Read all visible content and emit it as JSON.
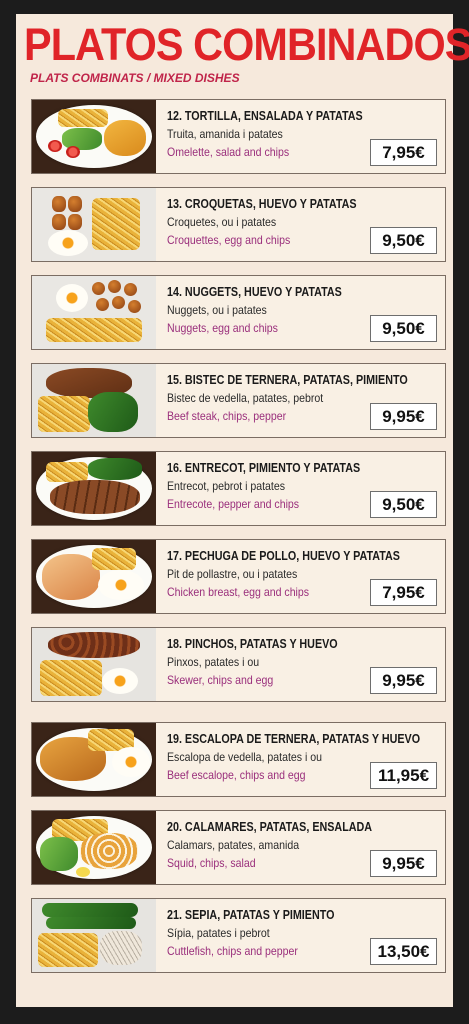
{
  "header": {
    "title": "PLATOS COMBINADOS",
    "subtitle": "PLATS COMBINATS  /  MIXED DISHES"
  },
  "items": [
    {
      "name": "12. TORTILLA, ENSALADA Y PATATAS",
      "catalan": "Truita, amanida i patates",
      "english": "Omelette, salad and chips",
      "price": "7,95€",
      "photo": "omelette-plate-image"
    },
    {
      "name": "13. CROQUETAS, HUEVO Y PATATAS",
      "catalan": "Croquetes, ou i patates",
      "english": "Croquettes, egg and chips",
      "price": "9,50€",
      "photo": "croquettes-plate-image"
    },
    {
      "name": "14. NUGGETS, HUEVO Y PATATAS",
      "catalan": "Nuggets, ou i patates",
      "english": "Nuggets, egg and chips",
      "price": "9,50€",
      "photo": "nuggets-plate-image"
    },
    {
      "name": "15. BISTEC DE TERNERA, PATATAS, PIMIENTO",
      "catalan": "Bistec de vedella, patates, pebrot",
      "english": "Beef steak, chips, pepper",
      "price": "9,95€",
      "photo": "beef-steak-plate-image"
    },
    {
      "name": "16. ENTRECOT, PIMIENTO Y PATATAS",
      "catalan": "Entrecot, pebrot i patates",
      "english": "Entrecote, pepper and chips",
      "price": "9,50€",
      "photo": "entrecote-plate-image"
    },
    {
      "name": "17. PECHUGA DE POLLO, HUEVO Y PATATAS",
      "catalan": "Pit de pollastre, ou i patates",
      "english": "Chicken breast, egg and chips",
      "price": "7,95€",
      "photo": "chicken-breast-plate-image"
    },
    {
      "name": "18. PINCHOS, PATATAS Y HUEVO",
      "catalan": "Pinxos, patates i ou",
      "english": "Skewer, chips and egg",
      "price": "9,95€",
      "photo": "skewer-plate-image"
    },
    {
      "name": "19. ESCALOPA DE TERNERA, PATATAS Y HUEVO",
      "catalan": "Escalopa de vedella, patates i ou",
      "english": "Beef escalope, chips and egg",
      "price": "11,95€",
      "photo": "escalope-plate-image"
    },
    {
      "name": "20. CALAMARES, PATATAS, ENSALADA",
      "catalan": "Calamars, patates, amanida",
      "english": "Squid, chips, salad",
      "price": "9,95€",
      "photo": "squid-plate-image"
    },
    {
      "name": "21. SEPIA, PATATAS Y PIMIENTO",
      "catalan": "Sípia, patates i pebrot",
      "english": "Cuttlefish, chips and pepper",
      "price": "13,50€",
      "photo": "cuttlefish-plate-image"
    }
  ],
  "colors": {
    "title": "#e02428",
    "subtitle": "#c0254a",
    "english_text": "#9a2f7c",
    "background": "#f6e9dc",
    "frame": "#1c1c1c"
  }
}
